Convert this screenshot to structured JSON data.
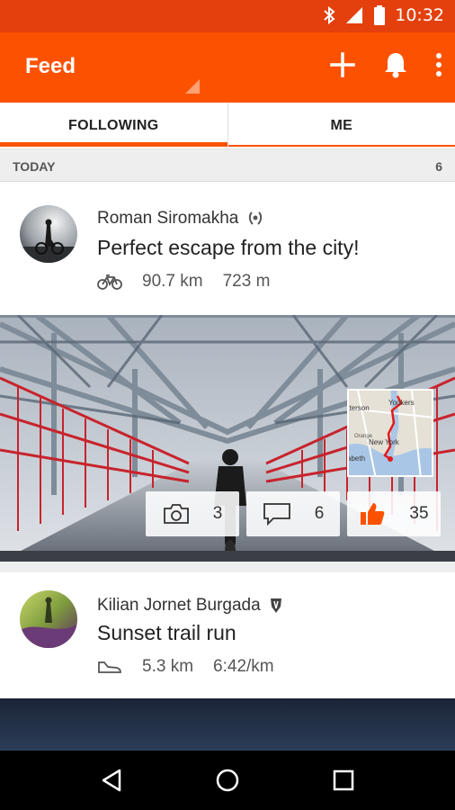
{
  "status_bar": {
    "time": "10:32",
    "icons": [
      "bluetooth-icon",
      "signal-icon",
      "battery-icon"
    ]
  },
  "app_bar": {
    "title": "Feed",
    "icons": [
      "plus-icon",
      "bell-icon",
      "overflow-menu-icon"
    ]
  },
  "tabs": [
    {
      "label": "FOLLOWING",
      "selected": true
    },
    {
      "label": "ME",
      "selected": false
    }
  ],
  "section": {
    "label": "TODAY",
    "count": "6"
  },
  "activities": [
    {
      "athlete": "Roman Siromakha",
      "badge_icon": "laurel-badge-icon",
      "title": "Perfect escape from the city!",
      "sport_icon": "bicycle-icon",
      "distance": "90.7 km",
      "elevation": "723 m",
      "map_labels": [
        "aterson",
        "Yonkers",
        "Orange",
        "New York",
        "abeth"
      ],
      "photos_count": "3",
      "comments_count": "6",
      "kudos_count": "35"
    },
    {
      "athlete": "Kilian Jornet Burgada",
      "badge_icon": "shield-badge-icon",
      "title": "Sunset trail run",
      "sport_icon": "shoe-icon",
      "distance": "5.3 km",
      "pace": "6:42/km"
    }
  ],
  "colors": {
    "brand": "#fc5200",
    "status_bar": "#e3400d",
    "kudos": "#fc5200"
  },
  "nav_bar": {
    "icons": [
      "back-icon",
      "home-icon",
      "recents-icon"
    ]
  }
}
